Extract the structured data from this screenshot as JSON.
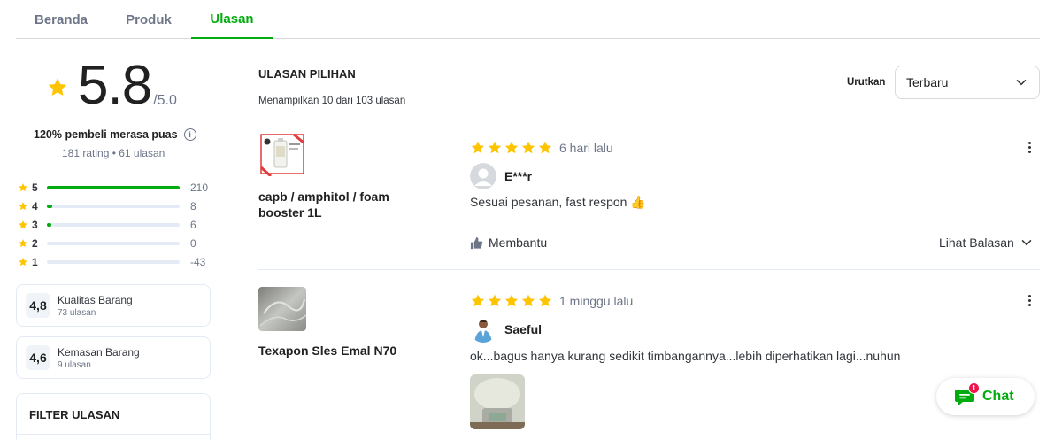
{
  "tabs": [
    "Beranda",
    "Produk",
    "Ulasan"
  ],
  "active_tab": "Ulasan",
  "summary": {
    "rating": "5.8",
    "max": "/5.0",
    "satisfaction": "120% pembeli merasa puas",
    "counts": "181 rating • 61 ulasan"
  },
  "distribution": [
    {
      "star": "5",
      "count": "210",
      "fraction": 1.0
    },
    {
      "star": "4",
      "count": "8",
      "fraction": 0.04
    },
    {
      "star": "3",
      "count": "6",
      "fraction": 0.03
    },
    {
      "star": "2",
      "count": "0",
      "fraction": 0.0
    },
    {
      "star": "1",
      "count": "-43",
      "fraction": 0.0
    }
  ],
  "aspects": [
    {
      "score": "4,8",
      "title": "Kualitas Barang",
      "sub": "73 ulasan"
    },
    {
      "score": "4,6",
      "title": "Kemasan Barang",
      "sub": "9 ulasan"
    }
  ],
  "filter": {
    "title": "FILTER ULASAN"
  },
  "reviews_header": {
    "title": "ULASAN PILIHAN",
    "showing": "Menampilkan 10 dari 103 ulasan",
    "sort_label": "Urutkan",
    "sort_value": "Terbaru"
  },
  "reviews": [
    {
      "product": "capb / amphitol / foam booster 1L",
      "stars": 5,
      "time": "6 hari lalu",
      "reviewer": "E***r",
      "text": "Sesuai pesanan, fast respon 👍",
      "helpful": "Membantu",
      "see_replies": "Lihat Balasan"
    },
    {
      "product": "Texapon Sles Emal N70",
      "stars": 5,
      "time": "1 minggu lalu",
      "reviewer": "Saeful",
      "text": "ok...bagus hanya kurang sedikit timbangannya...lebih diperhatikan lagi...nuhun"
    }
  ],
  "chat": {
    "label": "Chat",
    "badge": "1"
  },
  "colors": {
    "accent": "#03ac0e",
    "star": "#ffc400",
    "badge": "#ef144a"
  }
}
